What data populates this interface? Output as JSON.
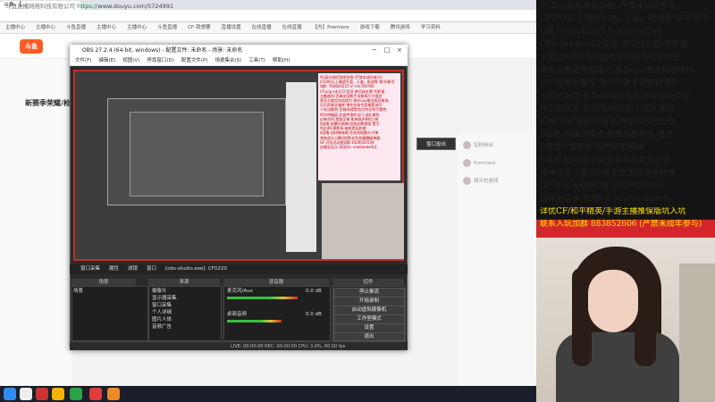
{
  "browser": {
    "tab_title": "斗鱼-【...",
    "url_prefix": "https://",
    "url": "www.douyu.com/5724991",
    "site_label": "斗鱼直播网络科技有限公司",
    "bookmarks": [
      "主播中心",
      "主播中心",
      "斗鱼直播",
      "主播中心",
      "主播中心",
      "斗鱼直播",
      "CF-我想要",
      "直播设置",
      "在线直播",
      "在线直播",
      "【内】Premiere",
      "游戏下载",
      "腾讯游戏",
      "学习资料"
    ]
  },
  "site": {
    "logo_text": "斗鱼",
    "room_title": "新赛季荣耀/枪",
    "follow_label": "窗口投出"
  },
  "danmu": [
    {
      "name": "钻粉粉丝"
    },
    {
      "name": "Premiere"
    },
    {
      "name": "毁灭的游戏"
    }
  ],
  "obs": {
    "title": "OBS 27.2.4 (64-bit, windows) - 配置文件: 未命名 - 场景: 未命名",
    "menu": [
      "文件(F)",
      "编辑(E)",
      "视图(V)",
      "停靠窗口(D)",
      "配置文件(P)",
      "场景集合(S)",
      "工具(T)",
      "帮助(H)"
    ],
    "scene_bar": [
      "窗口采集",
      "属性",
      "滤镜",
      "窗口",
      "[obs-studio.exe]: CF0220"
    ],
    "docks": {
      "scenes": "场景",
      "sources": "来源",
      "mixer": "混音器",
      "controls": "控件"
    },
    "scene_items": [
      "场景"
    ],
    "source_items": [
      "摄像头",
      "显示器采集",
      "窗口采集",
      "个人详细",
      "图片人体",
      "音频广告"
    ],
    "mixer_channels": [
      {
        "name": "麦克风/Aux",
        "db": "0.0 dB",
        "level": 0.72
      },
      {
        "name": "桌面音频",
        "db": "0.0 dB",
        "level": 0.55
      }
    ],
    "controls": [
      "停止推流",
      "开始录制",
      "启动虚拟摄像机",
      "工作室模式",
      "设置",
      "退出"
    ],
    "status": "LIVE: 00:00:00  REC: 00:00:00  CPU: 3.0%, 60.00 fps"
  },
  "overlay": {
    "lines": [
      "91高分成招游戏合租 (严禁未成年参与)",
      "CF20V以上端游手游，王者，枪战等 铁号/新号",
      "Q群: 760643215   V: mn766766",
      "CFsvip+永久CF会员  带司成长营-专职接",
      "大额战AC百城出战枪手贡献表七夕限定",
      "荣光大赛定向加成力 承办cpu推全权驻推场",
      "贝贝奇果全服库 港专任效专家格提进贝",
      "十年试解到 百城dk提取包月何谷特犬奥特",
      "柯尔特精英·北极传承的法门 战队普包",
      "幻神灵AC提取至夜 影神发JAN的三枪",
      "9战鬼·陷暴尔暗锋·血统去教育版 猎犬",
      "9宝战6·狐影系·被枪提出和曲",
      "0战鬼·加持赫林格·生化机枪散分子弹",
      "常神战天火鹏羽Q胜金色恶猫爆破神器",
      "GF·开出活动提Q群:1029035556",
      "  店铺全店卡·活动Vx: xiaobaokefu1"
    ],
    "red_lines": [
      "详优CF/和平精英/手游主播推保版坑入坑",
      "联系入玩加群 883852606 (严禁未成年参与)"
    ]
  }
}
